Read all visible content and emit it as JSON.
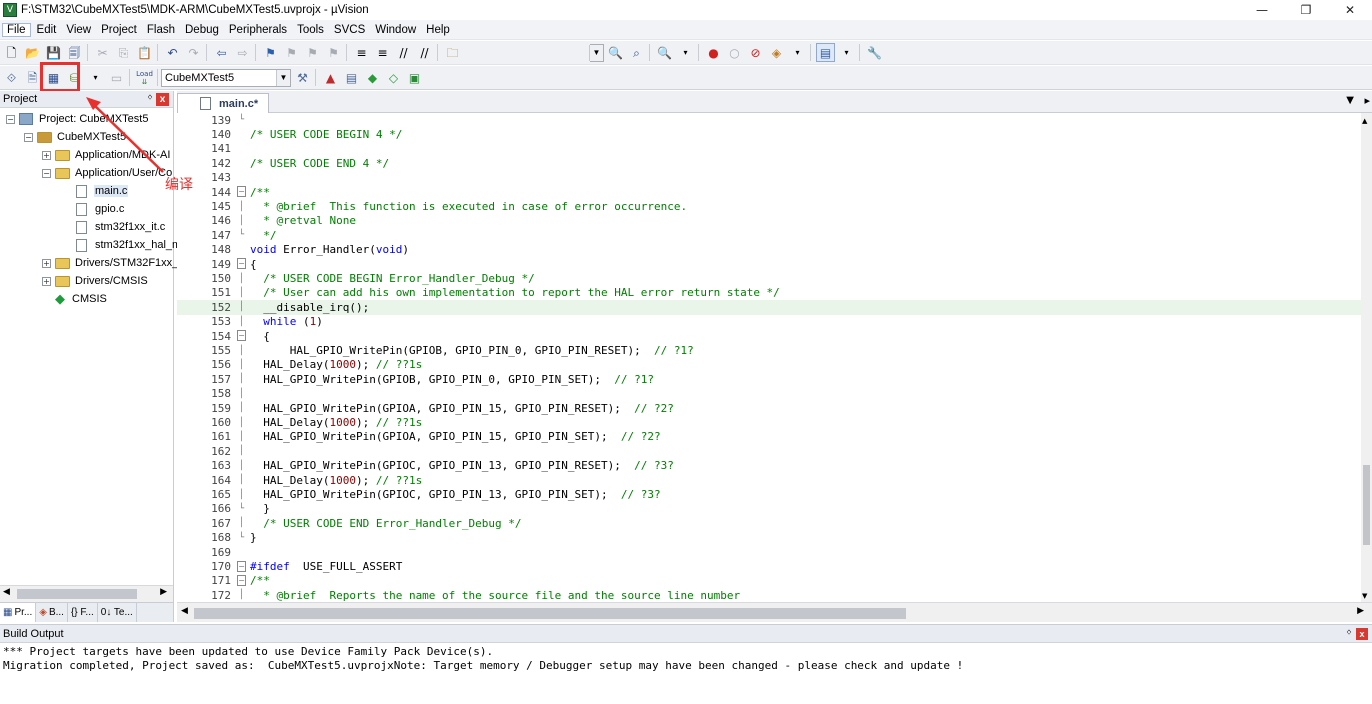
{
  "window": {
    "title": "F:\\STM32\\CubeMXTest5\\MDK-ARM\\CubeMXTest5.uvprojx - µVision",
    "icon_letter": "V",
    "minimize": "—",
    "maximize": "❐",
    "close": "✕"
  },
  "menubar": {
    "items": [
      "File",
      "Edit",
      "View",
      "Project",
      "Flash",
      "Debug",
      "Peripherals",
      "Tools",
      "SVCS",
      "Window",
      "Help"
    ]
  },
  "toolbar2": {
    "target_value": "CubeMXTest5",
    "load_label": "Load"
  },
  "project_panel": {
    "header": "Project",
    "pin": "ᛜ",
    "close": "x",
    "tree": [
      {
        "label": "Project: CubeMXTest5",
        "level": 0,
        "kind": "project",
        "expander": "−"
      },
      {
        "label": "CubeMXTest5",
        "level": 1,
        "kind": "target",
        "expander": "−"
      },
      {
        "label": "Application/MDK-AI",
        "level": 2,
        "kind": "folder",
        "expander": "+"
      },
      {
        "label": "Application/User/Co",
        "level": 2,
        "kind": "folder",
        "expander": "−"
      },
      {
        "label": "main.c",
        "level": 3,
        "kind": "file",
        "selected": true
      },
      {
        "label": "gpio.c",
        "level": 3,
        "kind": "file"
      },
      {
        "label": "stm32f1xx_it.c",
        "level": 3,
        "kind": "file"
      },
      {
        "label": "stm32f1xx_hal_m",
        "level": 3,
        "kind": "file"
      },
      {
        "label": "Drivers/STM32F1xx_",
        "level": 2,
        "kind": "folder",
        "expander": "+"
      },
      {
        "label": "Drivers/CMSIS",
        "level": 2,
        "kind": "folder",
        "expander": "+"
      },
      {
        "label": "CMSIS",
        "level": 2,
        "kind": "cmsis"
      }
    ],
    "bottom_tabs": [
      "Pr...",
      "B...",
      "{} F...",
      "0↓ Te..."
    ]
  },
  "annotation": {
    "text": "编译"
  },
  "editor": {
    "tab_label": "main.c*",
    "lines": [
      {
        "n": "139",
        "fold": "end",
        "text": ""
      },
      {
        "n": "140",
        "fold": "",
        "text": "/* USER CODE BEGIN 4 */",
        "cls": "c-com"
      },
      {
        "n": "141",
        "fold": "",
        "text": ""
      },
      {
        "n": "142",
        "fold": "",
        "text": "/* USER CODE END 4 */",
        "cls": "c-com"
      },
      {
        "n": "143",
        "fold": "",
        "text": ""
      },
      {
        "n": "144",
        "fold": "box",
        "text": "/**",
        "cls": "c-com"
      },
      {
        "n": "145",
        "fold": "line",
        "text": "  * @brief  This function is executed in case of error occurrence.",
        "cls": "c-com"
      },
      {
        "n": "146",
        "fold": "line",
        "text": "  * @retval None",
        "cls": "c-com"
      },
      {
        "n": "147",
        "fold": "end",
        "text": "  */",
        "cls": "c-com"
      },
      {
        "n": "148",
        "fold": "",
        "text": "void Error_Handler(void)",
        "cls": "mixed-void"
      },
      {
        "n": "149",
        "fold": "box",
        "text": "{"
      },
      {
        "n": "150",
        "fold": "line",
        "text": "  /* USER CODE BEGIN Error_Handler_Debug */",
        "cls": "c-com"
      },
      {
        "n": "151",
        "fold": "line",
        "text": "  /* User can add his own implementation to report the HAL error return state */",
        "cls": "c-com"
      },
      {
        "n": "152",
        "fold": "line",
        "text": "  __disable_irq();",
        "hl": true
      },
      {
        "n": "153",
        "fold": "line",
        "text": "  while (1)",
        "cls": "mixed-while"
      },
      {
        "n": "154",
        "fold": "box",
        "text": "  {"
      },
      {
        "n": "155",
        "fold": "line",
        "text": "      HAL_GPIO_WritePin(GPIOB, GPIO_PIN_0, GPIO_PIN_RESET);  // ?1?",
        "cls": "mixed-comment"
      },
      {
        "n": "156",
        "fold": "line",
        "text": "  HAL_Delay(1000); // ??1s",
        "cls": "mixed-delay"
      },
      {
        "n": "157",
        "fold": "line",
        "text": "  HAL_GPIO_WritePin(GPIOB, GPIO_PIN_0, GPIO_PIN_SET);  // ?1?",
        "cls": "mixed-comment"
      },
      {
        "n": "158",
        "fold": "line",
        "text": ""
      },
      {
        "n": "159",
        "fold": "line",
        "text": "  HAL_GPIO_WritePin(GPIOA, GPIO_PIN_15, GPIO_PIN_RESET);  // ?2?",
        "cls": "mixed-comment"
      },
      {
        "n": "160",
        "fold": "line",
        "text": "  HAL_Delay(1000); // ??1s",
        "cls": "mixed-delay"
      },
      {
        "n": "161",
        "fold": "line",
        "text": "  HAL_GPIO_WritePin(GPIOA, GPIO_PIN_15, GPIO_PIN_SET);  // ?2?",
        "cls": "mixed-comment"
      },
      {
        "n": "162",
        "fold": "line",
        "text": ""
      },
      {
        "n": "163",
        "fold": "line",
        "text": "  HAL_GPIO_WritePin(GPIOC, GPIO_PIN_13, GPIO_PIN_RESET);  // ?3?",
        "cls": "mixed-comment"
      },
      {
        "n": "164",
        "fold": "line",
        "text": "  HAL_Delay(1000); // ??1s",
        "cls": "mixed-delay"
      },
      {
        "n": "165",
        "fold": "line",
        "text": "  HAL_GPIO_WritePin(GPIOC, GPIO_PIN_13, GPIO_PIN_SET);  // ?3?",
        "cls": "mixed-comment"
      },
      {
        "n": "166",
        "fold": "end",
        "text": "  }"
      },
      {
        "n": "167",
        "fold": "line",
        "text": "  /* USER CODE END Error_Handler_Debug */",
        "cls": "c-com"
      },
      {
        "n": "168",
        "fold": "end",
        "text": "}"
      },
      {
        "n": "169",
        "fold": "",
        "text": ""
      },
      {
        "n": "170",
        "fold": "box",
        "text": "#ifdef  USE_FULL_ASSERT",
        "cls": "mixed-ifdef"
      },
      {
        "n": "171",
        "fold": "box",
        "text": "/**",
        "cls": "c-com"
      },
      {
        "n": "172",
        "fold": "line",
        "text": "  * @brief  Reports the name of the source file and the source line number",
        "cls": "c-com"
      }
    ]
  },
  "build_output": {
    "header": "Build Output",
    "lines": [
      "*** Project targets have been updated to use Device Family Pack Device(s).",
      "Migration completed, Project saved as:  CubeMXTest5.uvprojxNote: Target memory / Debugger setup may have been changed - please check and update !"
    ]
  },
  "colors": {
    "comment": "#008000",
    "keyword": "#0000ff",
    "number": "#8b0000",
    "highlight_line": "#e8f5e8",
    "annotation_red": "#e8302e"
  }
}
